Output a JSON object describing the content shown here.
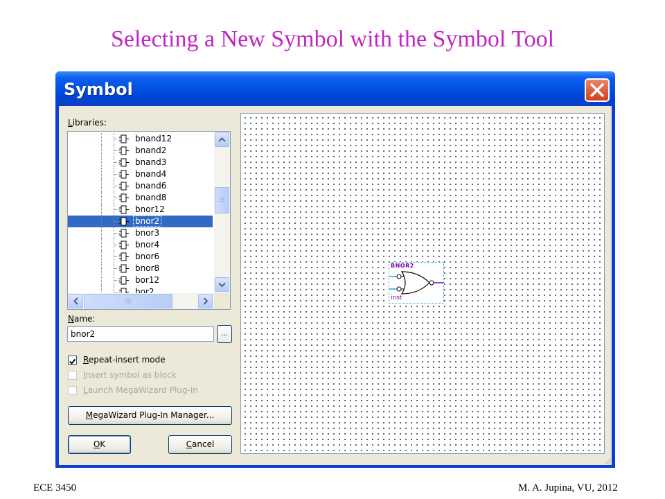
{
  "slide": {
    "title": "Selecting a New Symbol with the Symbol Tool",
    "footer_left": "ECE 3450",
    "footer_right": "M. A. Jupina, VU, 2012"
  },
  "dialog": {
    "title": "Symbol",
    "libraries_label_first": "L",
    "libraries_label_rest": "ibraries:",
    "library_items": [
      {
        "label": "bnand12",
        "selected": false
      },
      {
        "label": "bnand2",
        "selected": false
      },
      {
        "label": "bnand3",
        "selected": false
      },
      {
        "label": "bnand4",
        "selected": false
      },
      {
        "label": "bnand6",
        "selected": false
      },
      {
        "label": "bnand8",
        "selected": false
      },
      {
        "label": "bnor12",
        "selected": false
      },
      {
        "label": "bnor2",
        "selected": true
      },
      {
        "label": "bnor3",
        "selected": false
      },
      {
        "label": "bnor4",
        "selected": false
      },
      {
        "label": "bnor6",
        "selected": false
      },
      {
        "label": "bnor8",
        "selected": false
      },
      {
        "label": "bor12",
        "selected": false
      },
      {
        "label": "bor2",
        "selected": false
      }
    ],
    "name_label_first": "N",
    "name_label_rest": "ame:",
    "name_value": "bnor2",
    "browse_label": "...",
    "options": [
      {
        "first": "R",
        "rest": "epeat-insert mode",
        "checked": true,
        "enabled": true
      },
      {
        "first": "I",
        "rest": "nsert symbol as block",
        "checked": false,
        "enabled": false
      },
      {
        "first": "L",
        "rest": "aunch MegaWizard Plug-In",
        "checked": false,
        "enabled": false
      }
    ],
    "megawizard_first": "M",
    "megawizard_rest": "egaWizard Plug-In Manager...",
    "ok_first": "O",
    "ok_rest": "K",
    "cancel_first": "C",
    "cancel_rest": "ancel",
    "preview": {
      "symbol_name": "BNOR2",
      "instance": "inst"
    }
  },
  "colors": {
    "title": "#c026c0",
    "selection": "#316ac5",
    "symbol_text": "#8000a0"
  }
}
